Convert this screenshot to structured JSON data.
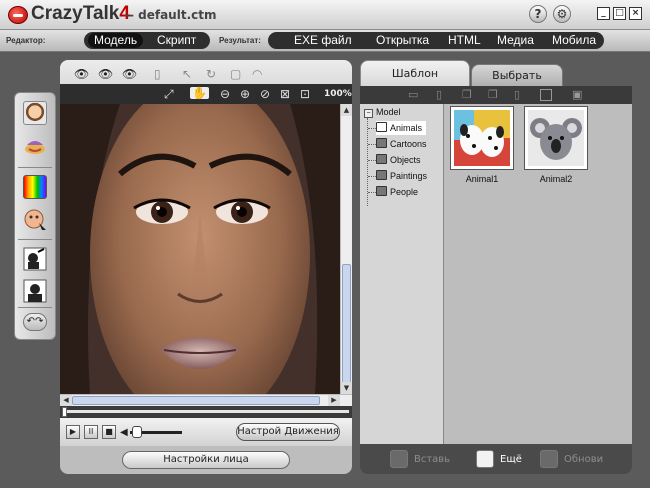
{
  "titlebar": {
    "app_name": "CrazyTalk",
    "app_version": "4",
    "document": "-- default.ctm",
    "help_glyph": "?",
    "tool_glyph": "⚙",
    "minimize_glyph": "_",
    "maximize_glyph": "□",
    "close_glyph": "×"
  },
  "modebar": {
    "editor_label": "Редактор:",
    "editor_tabs": [
      "Модель",
      "Скрипт"
    ],
    "editor_active": "Модель",
    "result_label": "Результат:",
    "result_tabs": [
      "EXE файл",
      "Открытка",
      "HTML",
      "Медиа",
      "Мобила"
    ]
  },
  "left_tools": [
    {
      "name": "face-fitting-icon"
    },
    {
      "name": "face-orientation-icon"
    },
    {
      "name": "color-adjust-icon"
    },
    {
      "name": "eye-settings-icon"
    },
    {
      "name": "mask-edit-icon"
    },
    {
      "name": "background-icon"
    },
    {
      "name": "undo-redo-icon"
    }
  ],
  "viewer": {
    "zoom_text": "100%",
    "top_tools": [
      "eye-view-icon",
      "eye-view-alt-icon",
      "eye-view-outline-icon",
      "page-icon",
      "pointer-icon",
      "rotate-icon",
      "layer-icon",
      "lips-icon"
    ],
    "view_tools": [
      "fit-icon",
      "hand-pan-icon",
      "zoom-out-icon",
      "zoom-in-icon",
      "reset-zoom-icon",
      "fit-window-icon",
      "actual-size-icon"
    ]
  },
  "transport": {
    "play_glyph": "▶",
    "pause_glyph": "II",
    "stop_glyph": "■",
    "volume_glyph": "◀",
    "volume_level": 0.1,
    "motion_button": "Настрой Движения"
  },
  "face_settings_button": "Настройки лица",
  "right_panel": {
    "tabs": [
      "Шаблон",
      "Выбрать"
    ],
    "active_tab": "Шаблон",
    "tree": {
      "root": "Model",
      "items": [
        "Animals",
        "Cartoons",
        "Objects",
        "Paintings",
        "People"
      ],
      "selected": "Animals"
    },
    "thumbnails": [
      {
        "label": "Animal1",
        "subject": "dalmatian puppies"
      },
      {
        "label": "Animal2",
        "subject": "koala"
      }
    ],
    "bottom": {
      "insert": "Вставь",
      "more": "Ещё",
      "update": "Обнови"
    }
  },
  "colors": {
    "brand_red": "#c00000",
    "panel_dark": "#2d2d2d",
    "panel_light": "#d6d6d6"
  }
}
